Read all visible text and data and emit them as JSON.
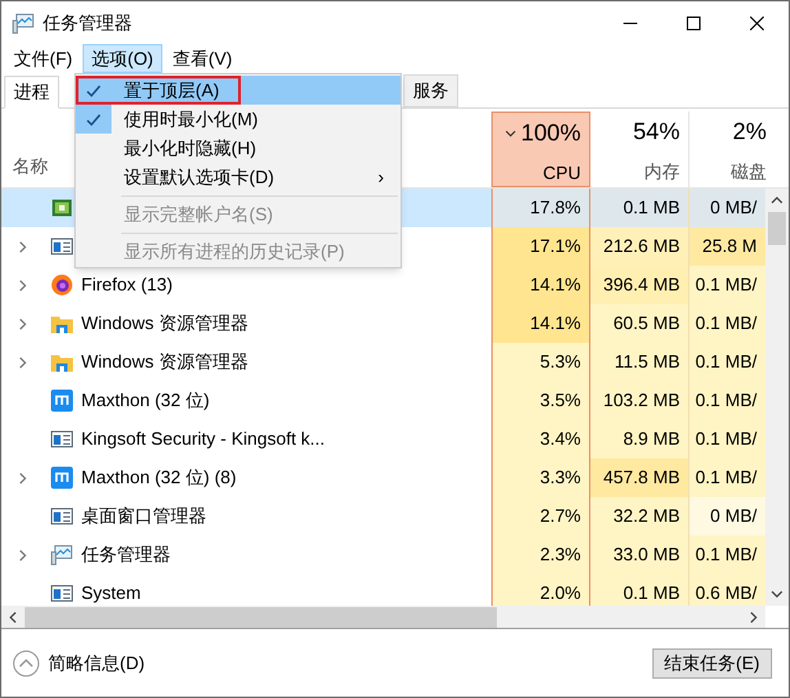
{
  "window": {
    "title": "任务管理器"
  },
  "menubar": [
    {
      "label": "文件(F)",
      "selected": false
    },
    {
      "label": "选项(O)",
      "selected": true
    },
    {
      "label": "查看(V)",
      "selected": false
    }
  ],
  "menu": [
    {
      "kind": "check",
      "label": "置于顶层(A)",
      "checked": true,
      "selected": true,
      "annotated": true,
      "disabled": false
    },
    {
      "kind": "check",
      "label": "使用时最小化(M)",
      "checked": true,
      "selected": false,
      "annotated": false,
      "disabled": false
    },
    {
      "kind": "check",
      "label": "最小化时隐藏(H)",
      "checked": false,
      "selected": false,
      "annotated": false,
      "disabled": false
    },
    {
      "kind": "submenu",
      "label": "设置默认选项卡(D)",
      "arrow": "›",
      "selected": false,
      "disabled": false
    },
    {
      "kind": "separator"
    },
    {
      "kind": "check",
      "label": "显示完整帐户名(S)",
      "checked": false,
      "selected": false,
      "annotated": false,
      "disabled": true
    },
    {
      "kind": "separator"
    },
    {
      "kind": "check",
      "label": "显示所有进程的历史记录(P)",
      "checked": false,
      "selected": false,
      "annotated": false,
      "disabled": true
    }
  ],
  "tabs": [
    {
      "label": "进程",
      "selected": true
    },
    {
      "label": "服务",
      "selected": false
    }
  ],
  "columns": {
    "name": "名称",
    "cpu": {
      "total": "100%",
      "label": "CPU",
      "sorted": true
    },
    "memory": {
      "total": "54%",
      "label": "内存"
    },
    "disk": {
      "total": "2%",
      "label": "磁盘"
    }
  },
  "rows": [
    {
      "kind": "app",
      "expandable": false,
      "selected": true,
      "cpu": {
        "text": "17.8%",
        "color": "#dde7ec"
      },
      "memory": {
        "text": "0.1 MB",
        "color": "#dde7ec"
      },
      "disk": {
        "text": "0 MB/",
        "color": "#dde7ec"
      }
    },
    {
      "kind": "window",
      "expandable": true,
      "selected": false,
      "cpu": {
        "text": "17.1%",
        "color": "#ffe58f"
      },
      "memory": {
        "text": "212.6 MB",
        "color": "#fff0b8"
      },
      "disk": {
        "text": "25.8 M",
        "color": "#ffe8a0"
      }
    },
    {
      "kind": "browser",
      "name": "Firefox (13)",
      "expandable": true,
      "selected": false,
      "cpu": {
        "text": "14.1%",
        "color": "#ffe58f"
      },
      "memory": {
        "text": "396.4 MB",
        "color": "#ffefb0"
      },
      "disk": {
        "text": "0.1 MB/",
        "color": "#fff4c4"
      }
    },
    {
      "kind": "folder",
      "name": "Windows 资源管理器",
      "expandable": true,
      "selected": false,
      "cpu": {
        "text": "14.1%",
        "color": "#ffe58f"
      },
      "memory": {
        "text": "60.5 MB",
        "color": "#fff4c4"
      },
      "disk": {
        "text": "0.1 MB/",
        "color": "#fff4c4"
      }
    },
    {
      "kind": "folder",
      "name": "Windows 资源管理器",
      "expandable": true,
      "selected": false,
      "cpu": {
        "text": "5.3%",
        "color": "#fff4c4"
      },
      "memory": {
        "text": "11.5 MB",
        "color": "#fff4c4"
      },
      "disk": {
        "text": "0.1 MB/",
        "color": "#fff4c4"
      }
    },
    {
      "kind": "tile",
      "name": "Maxthon (32 位)",
      "expandable": false,
      "selected": false,
      "cpu": {
        "text": "3.5%",
        "color": "#fff4c4"
      },
      "memory": {
        "text": "103.2 MB",
        "color": "#fff4c4"
      },
      "disk": {
        "text": "0.1 MB/",
        "color": "#fff4c4"
      }
    },
    {
      "kind": "window",
      "name": "Kingsoft Security - Kingsoft k...",
      "expandable": false,
      "selected": false,
      "cpu": {
        "text": "3.4%",
        "color": "#fff4c4"
      },
      "memory": {
        "text": "8.9 MB",
        "color": "#fff4c4"
      },
      "disk": {
        "text": "0.1 MB/",
        "color": "#fff4c4"
      }
    },
    {
      "kind": "tile",
      "name": "Maxthon (32 位) (8)",
      "expandable": true,
      "selected": false,
      "cpu": {
        "text": "3.3%",
        "color": "#fff4c4"
      },
      "memory": {
        "text": "457.8 MB",
        "color": "#ffe8a0"
      },
      "disk": {
        "text": "0.1 MB/",
        "color": "#fff4c4"
      }
    },
    {
      "kind": "window",
      "name": "桌面窗口管理器",
      "expandable": false,
      "selected": false,
      "cpu": {
        "text": "2.7%",
        "color": "#fff4c4"
      },
      "memory": {
        "text": "32.2 MB",
        "color": "#fff4c4"
      },
      "disk": {
        "text": "0 MB/",
        "color": "#fff9e2"
      }
    },
    {
      "kind": "monitor",
      "name": "任务管理器",
      "expandable": true,
      "selected": false,
      "cpu": {
        "text": "2.3%",
        "color": "#fff4c4"
      },
      "memory": {
        "text": "33.0 MB",
        "color": "#fff4c4"
      },
      "disk": {
        "text": "0.1 MB/",
        "color": "#fff4c4"
      }
    },
    {
      "kind": "window",
      "name": "System",
      "expandable": false,
      "selected": false,
      "cpu": {
        "text": "2.0%",
        "color": "#fff4c4"
      },
      "memory": {
        "text": "0.1 MB",
        "color": "#fff4c4"
      },
      "disk": {
        "text": "0.6 MB/",
        "color": "#fff4c4"
      }
    }
  ],
  "footer": {
    "details": "简略信息(D)",
    "end_task": "结束任务(E)"
  }
}
